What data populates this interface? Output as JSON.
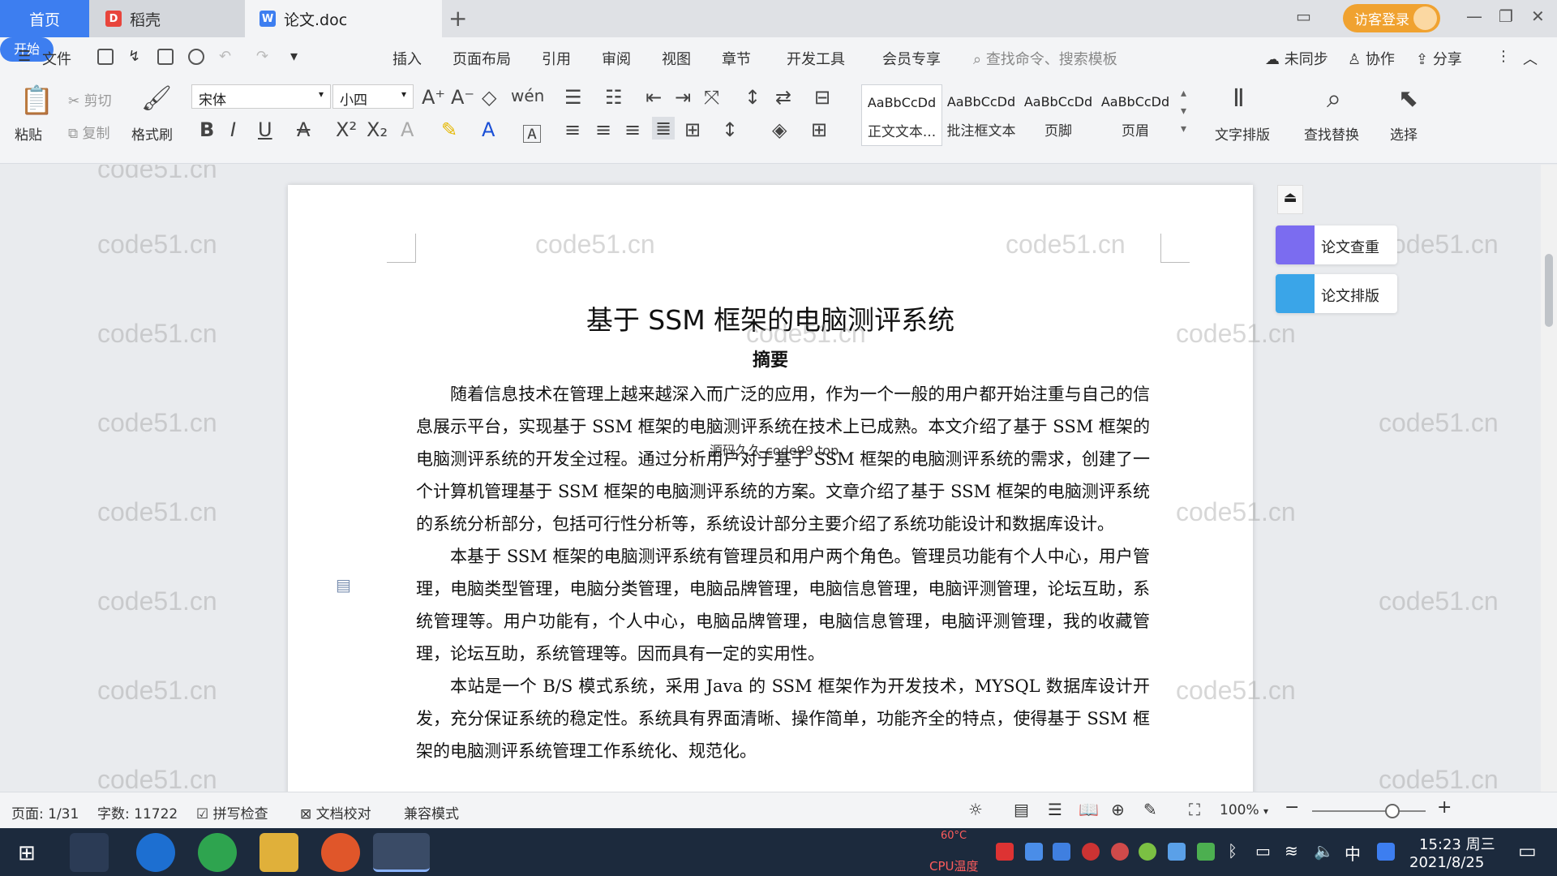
{
  "tabs": {
    "home": "首页",
    "shell": "稻壳",
    "doc": "论文.doc",
    "new_tab": "+"
  },
  "titlebar": {
    "visitor_login": "访客登录"
  },
  "menu": {
    "file": "文件",
    "items": [
      "开始",
      "插入",
      "页面布局",
      "引用",
      "审阅",
      "视图",
      "章节",
      "开发工具",
      "会员专享"
    ],
    "search_placeholder": "查找命令、搜索模板",
    "sync": "未同步",
    "collab": "协作",
    "share": "分享"
  },
  "ribbon": {
    "paste": "粘贴",
    "cut": "剪切",
    "copy": "复制",
    "format_painter": "格式刷",
    "font_name": "宋体",
    "font_size": "小四",
    "styles": [
      {
        "preview": "AaBbCcDd",
        "name": "正文文本..."
      },
      {
        "preview": "AaBbCcDd",
        "name": "批注框文本"
      },
      {
        "preview": "AaBbCcDd",
        "name": "页脚"
      },
      {
        "preview": "AaBbCcDd",
        "name": "页眉"
      }
    ],
    "text_layout": "文字排版",
    "find_replace": "查找替换",
    "select": "选择"
  },
  "document": {
    "title": "基于 SSM 框架的电脑测评系统",
    "abstract_heading": "摘要",
    "paragraphs": [
      "随着信息技术在管理上越来越深入而广泛的应用，作为一个一般的用户都开始注重与自己的信息展示平台，实现基于 SSM 框架的电脑测评系统在技术上已成熟。本文介绍了基于 SSM 框架的电脑测评系统的开发全过程。通过分析用户对于基于 SSM 框架的电脑测评系统的需求，创建了一个计算机管理基于 SSM 框架的电脑测评系统的方案。文章介绍了基于 SSM 框架的电脑测评系统的系统分析部分，包括可行性分析等，系统设计部分主要介绍了系统功能设计和数据库设计。",
      "本基于 SSM 框架的电脑测评系统有管理员和用户两个角色。管理员功能有个人中心，用户管理，电脑类型管理，电脑分类管理，电脑品牌管理，电脑信息管理，电脑评测管理，论坛互助，系统管理等。用户功能有，个人中心，电脑品牌管理，电脑信息管理，电脑评测管理，我的收藏管理，论坛互助，系统管理等。因而具有一定的实用性。",
      "本站是一个 B/S 模式系统，采用 Java 的 SSM 框架作为开发技术，MYSQL 数据库设计开发，充分保证系统的稳定性。系统具有界面清晰、操作简单，功能齐全的特点，使得基于 SSM 框架的电脑测评系统管理工作系统化、规范化。"
    ],
    "stamp": "源码久久 code99.top"
  },
  "side_panel": {
    "check": "论文查重",
    "layout": "论文排版"
  },
  "watermark": "code51.cn",
  "status": {
    "page": "页面: 1/31",
    "words": "字数: 11722",
    "spell": "拼写检查",
    "proof": "文档校对",
    "compat": "兼容模式",
    "zoom": "100%",
    "zoom_level_percent": 100
  },
  "taskbar": {
    "cpu": "CPU温度",
    "cpu_value": "60°C",
    "ime": "中",
    "time": "15:23 周三",
    "date": "2021/8/25"
  },
  "colors": {
    "accent": "#3d7ef0",
    "visitor": "#f0a230",
    "taskbar": "#1c2a3d",
    "check_icon": "#7b6cf0",
    "layout_icon": "#3aa5e8"
  }
}
